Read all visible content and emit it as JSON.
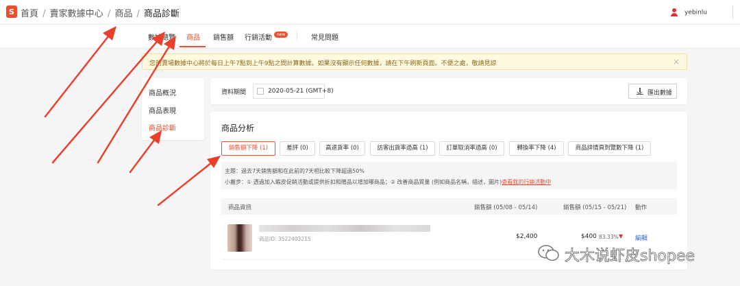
{
  "header": {
    "logo_letter": "S",
    "breadcrumb": [
      "首頁",
      "賣家數據中心",
      "商品",
      "商品診斷"
    ],
    "user_name": "yebinlu"
  },
  "tabs": [
    {
      "label": "數據總覽"
    },
    {
      "label": "商品"
    },
    {
      "label": "銷售額"
    },
    {
      "label": "行銷活動",
      "badge": "new"
    },
    {
      "label": "常見問題"
    }
  ],
  "notice": {
    "text": "您的賣場數據中心將於每日上午7點到上午9點之間計算數據。如果沒有顯示任何數據，請在下午刷新頁面。不便之處，敬請見諒",
    "close": "×"
  },
  "leftnav": {
    "items": [
      {
        "label": "商品概況"
      },
      {
        "label": "商品表現"
      },
      {
        "label": "商品診斷"
      }
    ]
  },
  "datebar": {
    "label": "資料期間",
    "value": "2020-05-21 (GMT+8)",
    "export_label": "匯出數據"
  },
  "analysis": {
    "title": "商品分析",
    "filters": [
      {
        "label": "銷售額下降 (1)"
      },
      {
        "label": "差評 (0)"
      },
      {
        "label": "高退貨率 (0)"
      },
      {
        "label": "訪客出貨率過高 (1)"
      },
      {
        "label": "訂單取消率過高 (0)"
      },
      {
        "label": "轉換率下降 (4)"
      },
      {
        "label": "商品詳情頁到覽數下降 (1)"
      }
    ],
    "tip_issue": "主題：過去7天銷售額和在此前的7天相比較下降超過50%",
    "tip_action_prefix": "小撇步：① 透過加入蝦皮促銷活動或提供折扣和贈品以增加曝商品；② 改善商品質量 (例如商品名稱，描述，圖片)",
    "tip_action_link": "查看我的行銷活動中",
    "columns": {
      "product": "商品資訊",
      "sales_prev": "銷售額 (05/08 - 05/14)",
      "sales_curr": "銷售額 (05/15 - 05/21)",
      "action": "動作"
    },
    "rows": [
      {
        "product_id": "商品ID: 3522403215",
        "sales_prev": "$2,400",
        "sales_curr": "$400",
        "change": "83.33%",
        "action": "編輯"
      }
    ]
  },
  "watermark": {
    "text": "大木说虾皮shopee"
  },
  "colors": {
    "accent": "#ee4d2d",
    "link": "#3a6fd8",
    "arrow": "#e8402a"
  }
}
